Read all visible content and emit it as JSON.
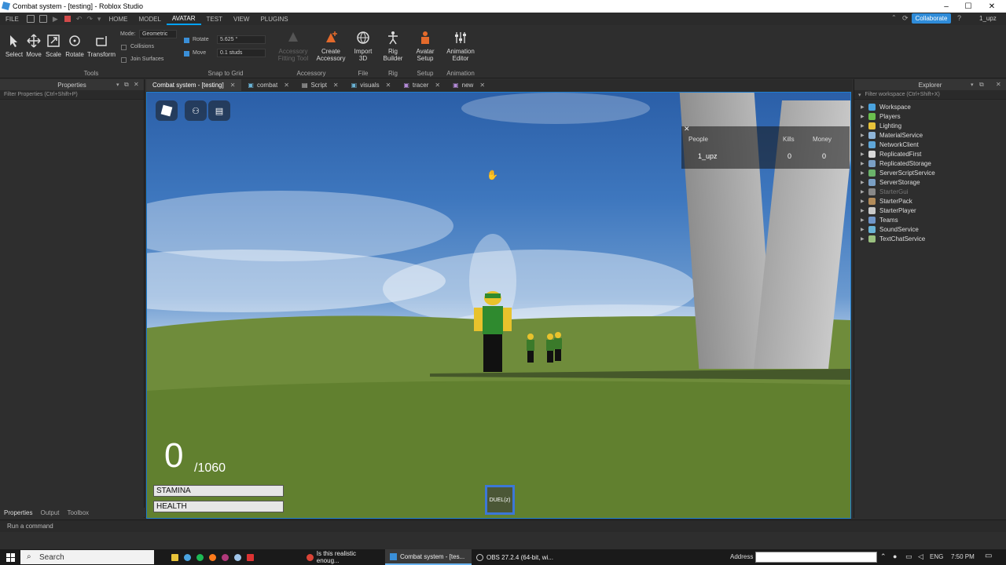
{
  "window": {
    "title": "Combat system - [testing] - Roblox Studio",
    "user": "1_upz",
    "collaborate": "Collaborate"
  },
  "menu": {
    "file": "FILE",
    "tabs": [
      "HOME",
      "MODEL",
      "AVATAR",
      "TEST",
      "VIEW",
      "PLUGINS"
    ],
    "active": "AVATAR"
  },
  "ribbon": {
    "tools": {
      "select": "Select",
      "move": "Move",
      "scale": "Scale",
      "rotate": "Rotate",
      "transform": "Transform",
      "group": "Tools"
    },
    "mode_label": "Mode:",
    "mode_value": "Geometric",
    "collisions": "Collisions",
    "join_surfaces": "Join Surfaces",
    "snap": {
      "rotate_label": "Rotate",
      "rotate_value": "5.625 °",
      "move_label": "Move",
      "move_value": "0.1 studs",
      "group": "Snap to Grid"
    },
    "accessory": {
      "fitting": "Accessory Fitting Tool",
      "create": "Create Accessory",
      "group": "Accessory"
    },
    "file": {
      "import": "Import 3D",
      "group": "File"
    },
    "rig": {
      "builder": "Rig Builder",
      "group": "Rig"
    },
    "setup": {
      "avatar": "Avatar Setup",
      "group": "Setup"
    },
    "animation": {
      "editor": "Animation Editor",
      "group": "Animation"
    }
  },
  "properties": {
    "title": "Properties",
    "filter": "Filter Properties (Ctrl+Shift+P)"
  },
  "doc_tabs": [
    "Combat system - [testing]",
    "combat",
    "Script",
    "visuals",
    "tracer",
    "new"
  ],
  "explorer": {
    "title": "Explorer",
    "filter": "Filter workspace (Ctrl+Shift+X)",
    "items": [
      {
        "name": "Workspace",
        "color": "#4aa3df"
      },
      {
        "name": "Players",
        "color": "#6bbf4e"
      },
      {
        "name": "Lighting",
        "color": "#e8c33a"
      },
      {
        "name": "MaterialService",
        "color": "#8fb5d9"
      },
      {
        "name": "NetworkClient",
        "color": "#5fa6d8"
      },
      {
        "name": "ReplicatedFirst",
        "color": "#d8d8d8"
      },
      {
        "name": "ReplicatedStorage",
        "color": "#7a9fc4"
      },
      {
        "name": "ServerScriptService",
        "color": "#6bb36b"
      },
      {
        "name": "ServerStorage",
        "color": "#7a9fc4"
      },
      {
        "name": "StarterGui",
        "color": "#888888"
      },
      {
        "name": "StarterPack",
        "color": "#b28b59"
      },
      {
        "name": "StarterPlayer",
        "color": "#c9c9c9"
      },
      {
        "name": "Teams",
        "color": "#6f95c8"
      },
      {
        "name": "SoundService",
        "color": "#6ab3d6"
      },
      {
        "name": "TextChatService",
        "color": "#9ac07f"
      }
    ]
  },
  "game": {
    "leaderboard": {
      "headers": [
        "People",
        "Kills",
        "Money"
      ],
      "row": {
        "name": "1_upz",
        "kills": "0",
        "money": "0"
      }
    },
    "count": "0",
    "count_max": "/1060",
    "stamina": "STAMINA",
    "health": "HEALTH",
    "duel": "DUEL(z)"
  },
  "panel_tabs": [
    "Properties",
    "Output",
    "Toolbox"
  ],
  "command_bar": "Run a command",
  "taskbar": {
    "search": "Search",
    "windows": [
      "Is this realistic enoug...",
      "Combat system - [tes...",
      "OBS 27.2.4 (64-bit, wi..."
    ],
    "address": "Address",
    "lang": "ENG",
    "time": "7:50 PM"
  }
}
